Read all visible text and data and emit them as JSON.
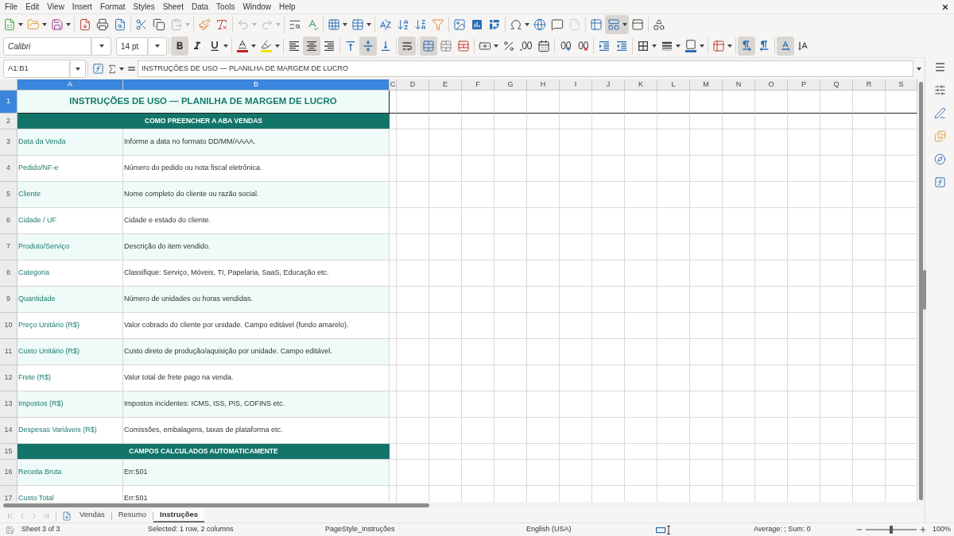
{
  "menu_bar": [
    "File",
    "Edit",
    "View",
    "Insert",
    "Format",
    "Styles",
    "Sheet",
    "Data",
    "Tools",
    "Window",
    "Help"
  ],
  "standard_toolbar": [
    [
      {
        "kind": "new",
        "pressed": false,
        "disabled": false
      },
      {
        "kind": "open",
        "pressed": false,
        "disabled": false
      },
      {
        "kind": "save",
        "pressed": false,
        "disabled": false
      }
    ],
    [
      {
        "kind": "export_pdf",
        "pressed": false,
        "disabled": false
      },
      {
        "kind": "print",
        "pressed": false,
        "disabled": false
      },
      {
        "kind": "print_preview",
        "pressed": false,
        "disabled": false
      }
    ],
    [
      {
        "kind": "cut",
        "pressed": false,
        "disabled": false
      },
      {
        "kind": "copy",
        "pressed": false,
        "disabled": false
      },
      {
        "kind": "paste",
        "pressed": false,
        "disabled": true
      }
    ],
    [
      {
        "kind": "clone_formatting",
        "pressed": false,
        "disabled": false
      },
      {
        "kind": "clear_formatting",
        "pressed": false,
        "disabled": false
      }
    ],
    [
      {
        "kind": "undo",
        "pressed": false,
        "disabled": true
      },
      {
        "kind": "redo",
        "pressed": false,
        "disabled": true
      }
    ],
    [
      {
        "kind": "find_replace",
        "pressed": false,
        "disabled": false
      },
      {
        "kind": "spelling",
        "pressed": false,
        "disabled": false
      }
    ],
    [
      {
        "kind": "rows",
        "pressed": false,
        "disabled": false
      },
      {
        "kind": "columns",
        "pressed": false,
        "disabled": false
      }
    ],
    [
      {
        "kind": "sort",
        "pressed": false,
        "disabled": false
      },
      {
        "kind": "sort_ascending",
        "pressed": false,
        "disabled": false
      },
      {
        "kind": "sort_descending",
        "pressed": false,
        "disabled": false
      },
      {
        "kind": "autofilter",
        "pressed": false,
        "disabled": false
      }
    ],
    [
      {
        "kind": "image",
        "pressed": false,
        "disabled": false
      },
      {
        "kind": "chart",
        "pressed": false,
        "disabled": false
      },
      {
        "kind": "pivot_table",
        "pressed": false,
        "disabled": false
      }
    ],
    [
      {
        "kind": "special_character",
        "pressed": false,
        "disabled": false
      },
      {
        "kind": "hyperlink",
        "pressed": false,
        "disabled": false
      },
      {
        "kind": "comment",
        "pressed": false,
        "disabled": false
      },
      {
        "kind": "header_footer",
        "pressed": false,
        "disabled": true
      }
    ],
    [
      {
        "kind": "print_area",
        "pressed": false,
        "disabled": false
      },
      {
        "kind": "freeze",
        "pressed": true,
        "disabled": false
      },
      {
        "kind": "split_window",
        "pressed": false,
        "disabled": false
      }
    ],
    [
      {
        "kind": "shapes",
        "pressed": false,
        "disabled": false
      }
    ]
  ],
  "formatting_toolbar": {
    "font_name": "Calibri",
    "font_size": "14 pt",
    "groups": [
      [
        {
          "kind": "bold",
          "pressed": true
        },
        {
          "kind": "italic",
          "pressed": false
        },
        {
          "kind": "underline",
          "pressed": false
        }
      ],
      [
        {
          "kind": "font_color",
          "pressed": false
        },
        {
          "kind": "highlight",
          "pressed": false
        }
      ],
      [
        {
          "kind": "align_left",
          "pressed": false
        },
        {
          "kind": "align_center",
          "pressed": true
        },
        {
          "kind": "align_right",
          "pressed": false
        }
      ],
      [
        {
          "kind": "align_top",
          "pressed": false
        },
        {
          "kind": "center_vertically",
          "pressed": true
        },
        {
          "kind": "align_bottom",
          "pressed": false
        }
      ],
      [
        {
          "kind": "wrap_text",
          "pressed": true
        }
      ],
      [
        {
          "kind": "merge_center",
          "pressed": true
        },
        {
          "kind": "merge_cells",
          "pressed": false
        },
        {
          "kind": "unmerge_cells",
          "pressed": false
        }
      ],
      [
        {
          "kind": "currency",
          "pressed": false
        },
        {
          "kind": "percent",
          "pressed": false
        },
        {
          "kind": "number",
          "pressed": false
        },
        {
          "kind": "date",
          "pressed": false
        }
      ],
      [
        {
          "kind": "add_decimal",
          "pressed": false
        },
        {
          "kind": "delete_decimal",
          "pressed": false
        }
      ],
      [
        {
          "kind": "increase_indent",
          "pressed": false
        },
        {
          "kind": "decrease_indent",
          "pressed": false
        }
      ],
      [
        {
          "kind": "borders",
          "pressed": false
        },
        {
          "kind": "border_style",
          "pressed": false
        },
        {
          "kind": "border_color",
          "pressed": false
        }
      ],
      [
        {
          "kind": "conditional",
          "pressed": false
        }
      ],
      [
        {
          "kind": "left_to_right",
          "pressed": true
        },
        {
          "kind": "right_to_left",
          "pressed": false
        }
      ],
      [
        {
          "kind": "text_direction",
          "pressed": true
        },
        {
          "kind": "stacked",
          "pressed": false
        }
      ]
    ]
  },
  "formula_bar": {
    "name_box": "A1:B1",
    "content": "INSTRUÇÕES DE USO — PLANILHA DE MARGEM DE LUCRO"
  },
  "sheet": {
    "columns": [
      {
        "label": "A",
        "selected": true
      },
      {
        "label": "B",
        "selected": true
      },
      {
        "label": "C",
        "selected": false
      },
      {
        "label": "D",
        "selected": false
      },
      {
        "label": "E",
        "selected": false
      },
      {
        "label": "F",
        "selected": false
      },
      {
        "label": "G",
        "selected": false
      },
      {
        "label": "H",
        "selected": false
      },
      {
        "label": "I",
        "selected": false
      },
      {
        "label": "J",
        "selected": false
      },
      {
        "label": "K",
        "selected": false
      },
      {
        "label": "L",
        "selected": false
      },
      {
        "label": "M",
        "selected": false
      },
      {
        "label": "N",
        "selected": false
      },
      {
        "label": "O",
        "selected": false
      },
      {
        "label": "P",
        "selected": false
      },
      {
        "label": "Q",
        "selected": false
      },
      {
        "label": "R",
        "selected": false
      },
      {
        "label": "S",
        "selected": false
      }
    ],
    "rows": [
      {
        "number": "1",
        "selected": true,
        "kind": "title",
        "text": "INSTRUÇÕES DE USO — PLANILHA DE MARGEM DE LUCRO"
      },
      {
        "number": "2",
        "selected": false,
        "kind": "section",
        "text": "COMO PREENCHER A ABA VENDAS"
      },
      {
        "number": "3",
        "selected": false,
        "kind": "field",
        "field": "Data da Venda",
        "description": "Informe a data no formato DD/MM/AAAA."
      },
      {
        "number": "4",
        "selected": false,
        "kind": "field",
        "field": "Pedido/NF-e",
        "description": "Número do pedido ou nota fiscal eletrônica."
      },
      {
        "number": "5",
        "selected": false,
        "kind": "field",
        "field": "Cliente",
        "description": "Nome completo do cliente ou razão social."
      },
      {
        "number": "6",
        "selected": false,
        "kind": "field",
        "field": "Cidade / UF",
        "description": "Cidade e estado do cliente."
      },
      {
        "number": "7",
        "selected": false,
        "kind": "field",
        "field": "Produto/Serviço",
        "description": "Descrição do item vendido."
      },
      {
        "number": "8",
        "selected": false,
        "kind": "field",
        "field": "Categoria",
        "description": "Classifique: Serviço, Móveis, TI, Papelaria, SaaS, Educação etc."
      },
      {
        "number": "9",
        "selected": false,
        "kind": "field",
        "field": "Quantidade",
        "description": "Número de unidades ou horas vendidas."
      },
      {
        "number": "10",
        "selected": false,
        "kind": "field",
        "field": "Preço Unitário (R$)",
        "description": "Valor cobrado do cliente por unidade. Campo editável (fundo amarelo)."
      },
      {
        "number": "11",
        "selected": false,
        "kind": "field",
        "field": "Custo Unitário (R$)",
        "description": "Custo direto de produção/aquisição por unidade. Campo editável."
      },
      {
        "number": "12",
        "selected": false,
        "kind": "field",
        "field": "Frete (R$)",
        "description": "Valor total de frete pago na venda."
      },
      {
        "number": "13",
        "selected": false,
        "kind": "field",
        "field": "Impostos (R$)",
        "description": "Impostos incidentes: ICMS, ISS, PIS, COFINS etc."
      },
      {
        "number": "14",
        "selected": false,
        "kind": "field",
        "field": "Despesas Variáveis (R$)",
        "description": "Comissões, embalagens, taxas de plataforma etc."
      },
      {
        "number": "15",
        "selected": false,
        "kind": "section",
        "text": "CAMPOS CALCULADOS AUTOMATICAMENTE"
      },
      {
        "number": "16",
        "selected": false,
        "kind": "field",
        "field": "Receita Bruta",
        "description": "Err:501"
      },
      {
        "number": "17",
        "selected": false,
        "kind": "field",
        "field": "Custo Total",
        "description": "Err:501"
      }
    ]
  },
  "sheet_tabs": [
    {
      "label": "Vendas",
      "selected": false
    },
    {
      "label": "Resumo",
      "selected": false
    },
    {
      "label": "Instruções",
      "selected": true
    }
  ],
  "status_bar": {
    "sheet": "Sheet 3 of 3",
    "selection": "Selected: 1 row, 2 columns",
    "page_style": "PageStyle_Instruções",
    "language": "English (USA)",
    "summary": "Average: ; Sum: 0",
    "zoom_slider": {
      "level": 0.5
    },
    "zoom": "100%"
  }
}
